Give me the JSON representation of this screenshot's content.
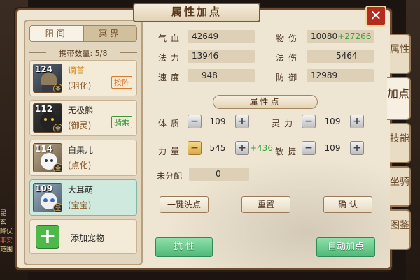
{
  "window": {
    "title": "属性加点",
    "close_icon": "✕"
  },
  "side_tabs": [
    "属性",
    "加点",
    "技能",
    "坐骑",
    "图鉴"
  ],
  "active_tab_index": 1,
  "realm_tabs": [
    {
      "label": "阳间"
    },
    {
      "label": "冥界"
    }
  ],
  "carry": {
    "label": "携带数量: 5/8"
  },
  "pets": [
    {
      "level": "124",
      "badge": "圣",
      "name": "谪首",
      "subtitle": "(羽化)",
      "stamp": "按阵"
    },
    {
      "level": "112",
      "badge": "金",
      "name": "无极熊",
      "subtitle": "(御灵)",
      "stamp": "骑乘"
    },
    {
      "level": "114",
      "badge": "金",
      "name": "白果儿",
      "subtitle": "(点化)",
      "stamp": ""
    },
    {
      "level": "109",
      "badge": "圣",
      "name": "大耳萌",
      "subtitle": "(宝宝)",
      "stamp": ""
    }
  ],
  "add_pet": {
    "label": "添加宠物",
    "icon": "+"
  },
  "stats": {
    "hp": {
      "label": "气血",
      "value": "42649"
    },
    "mp": {
      "label": "法力",
      "value": "13946"
    },
    "speed": {
      "label": "速度",
      "value": "948"
    },
    "phys_atk": {
      "label": "物伤",
      "value": "10080",
      "bonus": "+27266"
    },
    "mag_atk": {
      "label": "法伤",
      "value": "5464"
    },
    "defense": {
      "label": "防御",
      "value": "12989"
    }
  },
  "attr_section": {
    "title": "属性点"
  },
  "attributes": {
    "constitution": {
      "label": "体质",
      "value": "109"
    },
    "spirit": {
      "label": "灵力",
      "value": "109"
    },
    "strength": {
      "label": "力量",
      "value": "545",
      "bonus": "+436"
    },
    "agility": {
      "label": "敏捷",
      "value": "109"
    },
    "unallocated": {
      "label": "未分配",
      "value": "0"
    }
  },
  "buttons": {
    "reset_all": "一键洗点",
    "reset": "重置",
    "confirm": "确 认",
    "resist": "抗  性",
    "auto_assign": "自动加点"
  },
  "background_text": [
    "昆",
    "玄",
    "降伏",
    "非安",
    "范围"
  ]
}
